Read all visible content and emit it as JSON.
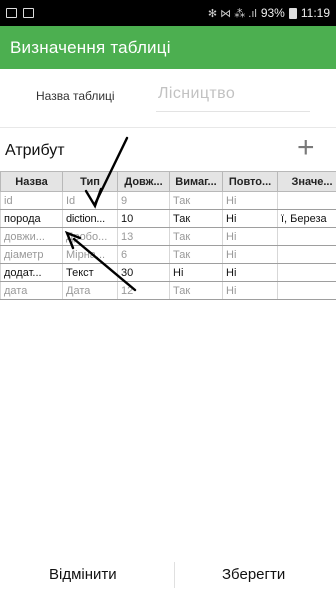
{
  "status_bar": {
    "signal_glyphs": "✻ ⋈ ⁂ .ıl",
    "battery": "93%",
    "time": "11:19"
  },
  "app_bar": {
    "title": "Визначення таблиці"
  },
  "table_name": {
    "label": "Назва таблиці",
    "value": "Лісництво"
  },
  "attributes": {
    "title": "Атрибут",
    "add_icon": "plus-icon",
    "add_glyph": "+",
    "columns": [
      "Назва",
      "Тип",
      "Довж...",
      "Вимаг...",
      "Повто...",
      "Значе..."
    ],
    "rows": [
      {
        "name": "id",
        "type": "Id",
        "length": "9",
        "required": "Так",
        "repeat": "Ні",
        "values": "",
        "style": "dim"
      },
      {
        "name": "порода",
        "type": "diction...",
        "length": "10",
        "required": "Так",
        "repeat": "Ні",
        "values": "ї, Береза",
        "style": "dark"
      },
      {
        "name": "довжи...",
        "type": "Дробо...",
        "length": "13",
        "required": "Так",
        "repeat": "Ні",
        "values": "",
        "style": "dim"
      },
      {
        "name": "діаметр",
        "type": "Мірна...",
        "length": "6",
        "required": "Так",
        "repeat": "Ні",
        "values": "",
        "style": "dim"
      },
      {
        "name": "додат...",
        "type": "Текст",
        "length": "30",
        "required": "Ні",
        "repeat": "Ні",
        "values": "",
        "style": "dark"
      },
      {
        "name": "дата",
        "type": "Дата",
        "length": "12",
        "required": "Так",
        "repeat": "Ні",
        "values": "",
        "style": "dim"
      }
    ]
  },
  "footer": {
    "cancel_label": "Відмінити",
    "save_label": "Зберегти"
  },
  "colors": {
    "accent": "#4caf50",
    "statusbar": "#000000",
    "header_bg": "#e4e4e4"
  }
}
